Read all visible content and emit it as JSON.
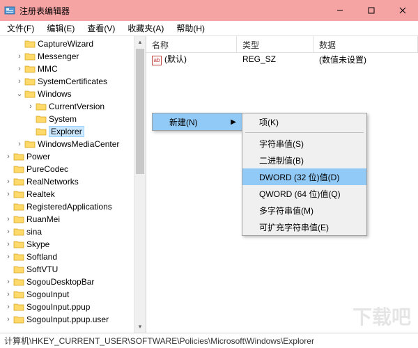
{
  "window": {
    "title": "注册表编辑器"
  },
  "menu": {
    "file": "文件(F)",
    "edit": "编辑(E)",
    "view": "查看(V)",
    "favorites": "收藏夹(A)",
    "help": "帮助(H)"
  },
  "tree": {
    "items": [
      {
        "label": "CaptureWizard",
        "indent": 1,
        "tw": ""
      },
      {
        "label": "Messenger",
        "indent": 1,
        "tw": ">"
      },
      {
        "label": "MMC",
        "indent": 1,
        "tw": ">"
      },
      {
        "label": "SystemCertificates",
        "indent": 1,
        "tw": ">"
      },
      {
        "label": "Windows",
        "indent": 1,
        "tw": "v"
      },
      {
        "label": "CurrentVersion",
        "indent": 2,
        "tw": ">"
      },
      {
        "label": "System",
        "indent": 2,
        "tw": ""
      },
      {
        "label": "Explorer",
        "indent": 2,
        "tw": "",
        "sel": true
      },
      {
        "label": "WindowsMediaCenter",
        "indent": 1,
        "tw": ">"
      },
      {
        "label": "Power",
        "indent": 0,
        "tw": ">"
      },
      {
        "label": "PureCodec",
        "indent": 0,
        "tw": ""
      },
      {
        "label": "RealNetworks",
        "indent": 0,
        "tw": ">"
      },
      {
        "label": "Realtek",
        "indent": 0,
        "tw": ">"
      },
      {
        "label": "RegisteredApplications",
        "indent": 0,
        "tw": ""
      },
      {
        "label": "RuanMei",
        "indent": 0,
        "tw": ">"
      },
      {
        "label": "sina",
        "indent": 0,
        "tw": ">"
      },
      {
        "label": "Skype",
        "indent": 0,
        "tw": ">"
      },
      {
        "label": "Softland",
        "indent": 0,
        "tw": ">"
      },
      {
        "label": "SoftVTU",
        "indent": 0,
        "tw": ""
      },
      {
        "label": "SogouDesktopBar",
        "indent": 0,
        "tw": ">"
      },
      {
        "label": "SogouInput",
        "indent": 0,
        "tw": ">"
      },
      {
        "label": "SogouInput.ppup",
        "indent": 0,
        "tw": ">"
      },
      {
        "label": "SogouInput.ppup.user",
        "indent": 0,
        "tw": ">"
      }
    ]
  },
  "list": {
    "cols": {
      "name": "名称",
      "type": "类型",
      "data": "数据"
    },
    "row": {
      "name": "(默认)",
      "type": "REG_SZ",
      "data": "(数值未设置)"
    }
  },
  "ctx": {
    "parent": {
      "new": "新建(N)"
    },
    "child": {
      "key": "项(K)",
      "string": "字符串值(S)",
      "binary": "二进制值(B)",
      "dword": "DWORD (32 位)值(D)",
      "qword": "QWORD (64 位)值(Q)",
      "multi": "多字符串值(M)",
      "expand": "可扩充字符串值(E)"
    }
  },
  "status": {
    "path": "计算机\\HKEY_CURRENT_USER\\SOFTWARE\\Policies\\Microsoft\\Windows\\Explorer"
  },
  "watermark": "下载吧"
}
